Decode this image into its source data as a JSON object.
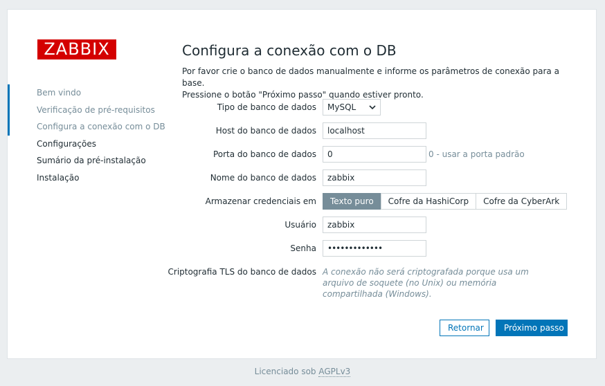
{
  "logo_text": "ZABBIX",
  "steps": [
    {
      "label": "Bem vindo",
      "state": "done"
    },
    {
      "label": "Verificação de pré-requisitos",
      "state": "done"
    },
    {
      "label": "Configura a conexão com o DB",
      "state": "current"
    },
    {
      "label": "Configurações",
      "state": "pending"
    },
    {
      "label": "Sumário da pré-instalação",
      "state": "pending"
    },
    {
      "label": "Instalação",
      "state": "pending"
    }
  ],
  "title": "Configura a conexão com o DB",
  "intro_line1": "Por favor crie o banco de dados manualmente e informe os parâmetros de conexão para a base.",
  "intro_line2": "Pressione o botão \"Próximo passo\" quando estiver pronto.",
  "form": {
    "db_type": {
      "label": "Tipo de banco de dados",
      "value": "MySQL"
    },
    "db_host": {
      "label": "Host do banco de dados",
      "value": "localhost"
    },
    "db_port": {
      "label": "Porta do banco de dados",
      "value": "0",
      "hint": "0 - usar a porta padrão"
    },
    "db_name": {
      "label": "Nome do banco de dados",
      "value": "zabbix"
    },
    "creds": {
      "label": "Armazenar credenciais em",
      "options": [
        "Texto puro",
        "Cofre da HashiCorp",
        "Cofre da CyberArk"
      ],
      "selected": "Texto puro"
    },
    "user": {
      "label": "Usuário",
      "value": "zabbix"
    },
    "password": {
      "label": "Senha",
      "value": "•••••••••••••"
    },
    "tls": {
      "label": "Criptografia TLS do banco de dados",
      "note": "A conexão não será criptografada porque usa um arquivo de soquete (no Unix) ou memória compartilhada (Windows)."
    }
  },
  "buttons": {
    "back": "Retornar",
    "next": "Próximo passo"
  },
  "footer": {
    "prefix": "Licenciado sob",
    "link": "AGPLv3"
  },
  "colors": {
    "brand": "#d40000",
    "accent": "#0275b8",
    "muted": "#768d99"
  }
}
